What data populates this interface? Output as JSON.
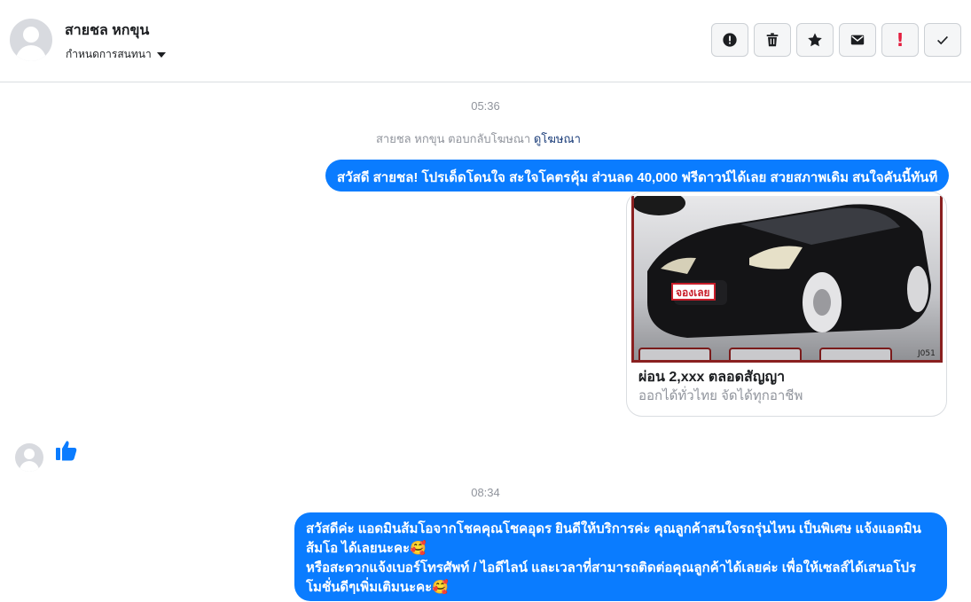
{
  "header": {
    "contact_name": "สายชล หกขุน",
    "settings_label": "กำหนดการสนทนา"
  },
  "toolbar": {
    "icons": [
      "alert-circle-icon",
      "trash-icon",
      "star-icon",
      "envelope-icon",
      "exclamation-icon",
      "check-icon"
    ],
    "exclamation_glyph": "!"
  },
  "thread": {
    "timestamp_1": "05:36",
    "reply_note": "สายชล หกขุน ตอบกลับโฆษณา",
    "reply_link": "ดูโฆษณา",
    "message_1": "สวัสดี สายชล! โปรเด็ดโดนใจ สะใจโคตรคุ้ม ส่วนลด 40,000 ฟรีดาวน์ได้เลย สวยสภาพเดิม สนใจคันนี้ทันที",
    "card_image_label": "จองเลย",
    "card_image_code": "J051",
    "card_title": "ผ่อน 2,xxx ตลอดสัญญา",
    "card_subtitle": "ออกได้ทั่วไทย จัดได้ทุกอาชีพ",
    "timestamp_2": "08:34",
    "message_2_line_1": "สวัสดีค่ะ แอดมินส้มโอจากโชคคุณโชคอุดร ยินดีให้บริการค่ะ   คุณลูกค้าสนใจรถรุ่นไหน เป็นพิเศษ แจ้งแอดมิน",
    "message_2_line_2": "ส้มโอ ได้เลยนะคะ🥰",
    "message_2_line_3": "หรือสะดวกแจ้งเบอร์โทรศัพท์ / ไอดีไลน์ และเวลาที่สามารถติดต่อคุณลูกค้าได้เลยค่ะ เพื่อให้เซลส์ได้เสนอโปร",
    "message_2_line_4": "โมชั่นดีๆเพิ่มเติมนะคะ🥰"
  },
  "colors": {
    "bubble": "#0a7cff",
    "like": "#0a7cff",
    "alert": "#e41e3f"
  }
}
